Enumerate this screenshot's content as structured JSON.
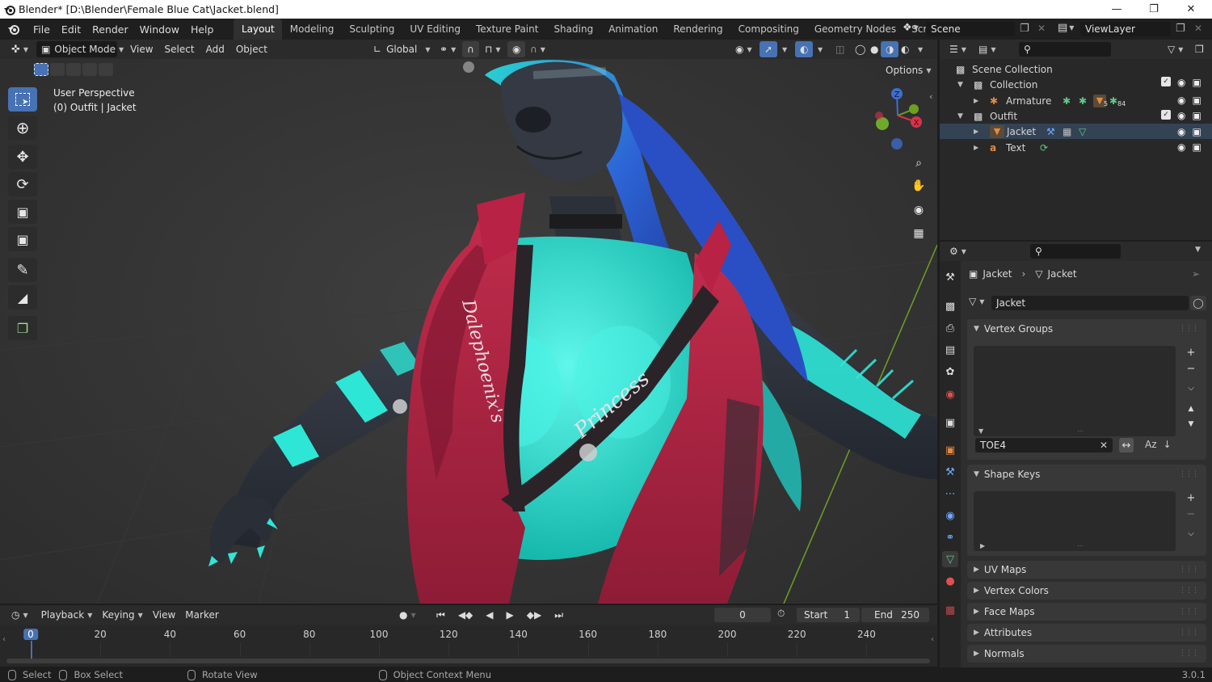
{
  "window": {
    "title": "Blender* [D:\\Blender\\Female Blue Cat\\Jacket.blend]",
    "controls": [
      "minimize-icon",
      "restore-icon",
      "close-icon"
    ]
  },
  "menu": [
    "File",
    "Edit",
    "Render",
    "Window",
    "Help"
  ],
  "workspaces": [
    {
      "label": "Layout",
      "active": true
    },
    {
      "label": "Modeling"
    },
    {
      "label": "Sculpting"
    },
    {
      "label": "UV Editing"
    },
    {
      "label": "Texture Paint"
    },
    {
      "label": "Shading"
    },
    {
      "label": "Animation"
    },
    {
      "label": "Rendering"
    },
    {
      "label": "Compositing"
    },
    {
      "label": "Geometry Nodes"
    },
    {
      "label": "Scripting"
    }
  ],
  "add_workspace": "+",
  "scene": {
    "label": "Scene"
  },
  "view_layer": {
    "label": "ViewLayer"
  },
  "viewport_header": {
    "mode": "Object Mode",
    "menus": [
      "View",
      "Select",
      "Add",
      "Object"
    ],
    "transform_orientation": "Global",
    "options": "Options"
  },
  "viewport": {
    "perspective": "User Perspective",
    "context": "(0) Outfit | Jacket",
    "jacket_text_left": "Dalephoenix's",
    "jacket_text_right": "Princess",
    "gizmo": {
      "z": "Z",
      "x": "X",
      "y": "Y"
    }
  },
  "tools": [
    "select-box-icon",
    "cursor-icon",
    "move-icon",
    "rotate-icon",
    "scale-icon",
    "transform-icon",
    "annotate-icon",
    "measure-icon",
    "add-cube-icon"
  ],
  "outliner": {
    "rows": [
      {
        "label": "Scene Collection",
        "icon": "scene-collection-icon"
      },
      {
        "label": "Collection",
        "icon": "collection-icon"
      },
      {
        "label": "Armature",
        "icon": "armature-icon"
      },
      {
        "label": "Outfit",
        "icon": "collection-icon"
      },
      {
        "label": "Jacket",
        "icon": "mesh-icon"
      },
      {
        "label": "Text",
        "icon": "text-icon"
      }
    ],
    "armature_badge_1": "5",
    "armature_badge_2": "84"
  },
  "properties": {
    "breadcrumb_object": "Jacket",
    "breadcrumb_data": "Jacket",
    "data_name": "Jacket",
    "panels": {
      "vertex_groups": "Vertex Groups",
      "shape_keys": "Shape Keys",
      "uv_maps": "UV Maps",
      "vertex_colors": "Vertex Colors",
      "face_maps": "Face Maps",
      "attributes": "Attributes",
      "normals": "Normals"
    },
    "vertex_group_filter": "TOE4",
    "sort_label": "Az"
  },
  "timeline": {
    "menus": [
      "Playback",
      "Keying",
      "View",
      "Marker"
    ],
    "current_frame": "0",
    "start_label": "Start",
    "start": "1",
    "end_label": "End",
    "end": "250",
    "ticks": [
      "0",
      "20",
      "40",
      "60",
      "80",
      "100",
      "120",
      "140",
      "160",
      "180",
      "200",
      "220",
      "240"
    ]
  },
  "status": {
    "select": "Select",
    "box_select": "Box Select",
    "rotate_view": "Rotate View",
    "context_menu": "Object Context Menu",
    "version": "3.0.1"
  },
  "colors": {
    "accent": "#4772b3",
    "fur_teal": "#2ee6d6",
    "jacket_red": "#a8223f",
    "hair_blue": "#2a55c8",
    "body_dark": "#2c3038"
  }
}
